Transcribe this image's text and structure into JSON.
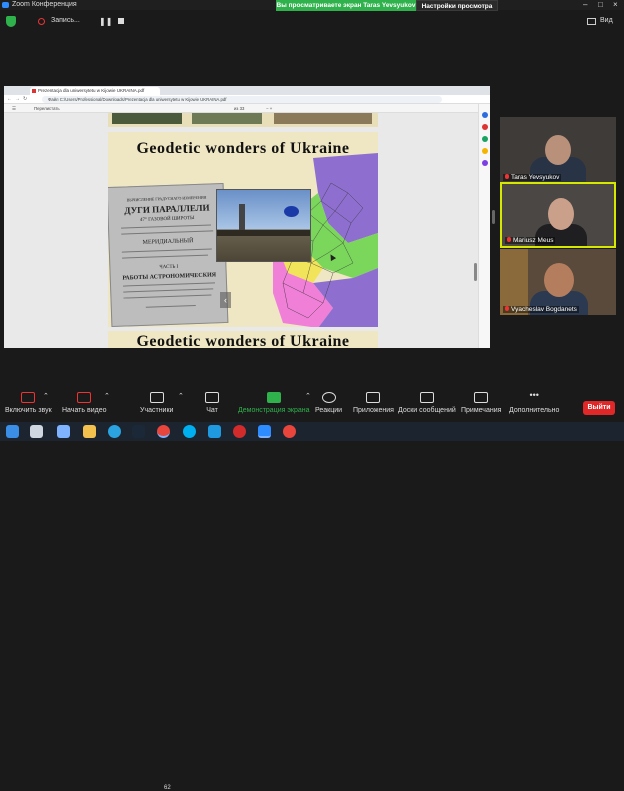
{
  "window": {
    "title": "Zoom Конференция"
  },
  "share_banner": {
    "text": "Вы просматриваете экран Taras Yevsyukov",
    "view_settings": "Настройки просмотра"
  },
  "topbar": {
    "recording_label": "Запись...",
    "view_label": "Вид"
  },
  "browser": {
    "tab_title": "Prezentacja dla uniwersytetu w Kijowie UKRAINA.pdf",
    "url": "Файл   C:/Users/Professional/Downloads/Prezentacja dla uniwersytetu w Kijowie UKRAINA.pdf",
    "pdf_toolbar": {
      "menu": "Перелистать",
      "page_info": "из 33",
      "zoom": "−  +"
    }
  },
  "slide": {
    "title": "Geodetic wonders of Ukraine",
    "next_title": "Geodetic wonders of Ukraine"
  },
  "book": {
    "line1": "ДУГИ ПАРАЛЛЕЛИ",
    "line2": "47° ГАЗОВОЙ ШИРОТЫ",
    "line3": "МЕРИДИАЛЬНЫЙ",
    "line4": "ЧАСТЬ I",
    "line5": "РАБОТЫ АСТРОНОМИЧЕСКИЯ"
  },
  "participants": [
    {
      "name": "Taras Yevsyukov",
      "muted": true,
      "active": false
    },
    {
      "name": "Mariusz Meus",
      "muted": true,
      "active": true
    },
    {
      "name": "Vyacheslav Bogdanets",
      "muted": true,
      "active": false
    }
  ],
  "toolbar": {
    "unmute": "Включить звук",
    "start_video": "Начать видео",
    "participants": "Участники",
    "participants_count": "62",
    "chat": "Чат",
    "share": "Демонстрация экрана",
    "reactions": "Реакции",
    "apps": "Приложения",
    "whiteboards": "Доски сообщений",
    "notes": "Примечания",
    "more": "Дополнительно",
    "leave": "Выйти"
  },
  "colors": {
    "share_green": "#2fb14c",
    "leave_red": "#e02828",
    "active_speaker": "#d6e800",
    "slide_bg": "#efe7c4"
  },
  "taskbar_apps": [
    "start-icon",
    "taskview-icon",
    "notepad-icon",
    "explorer-icon",
    "telegram-icon",
    "steam-icon",
    "chrome-icon",
    "skype-icon",
    "edge-icon",
    "opera-icon",
    "zoom-icon",
    "chrome-icon"
  ]
}
